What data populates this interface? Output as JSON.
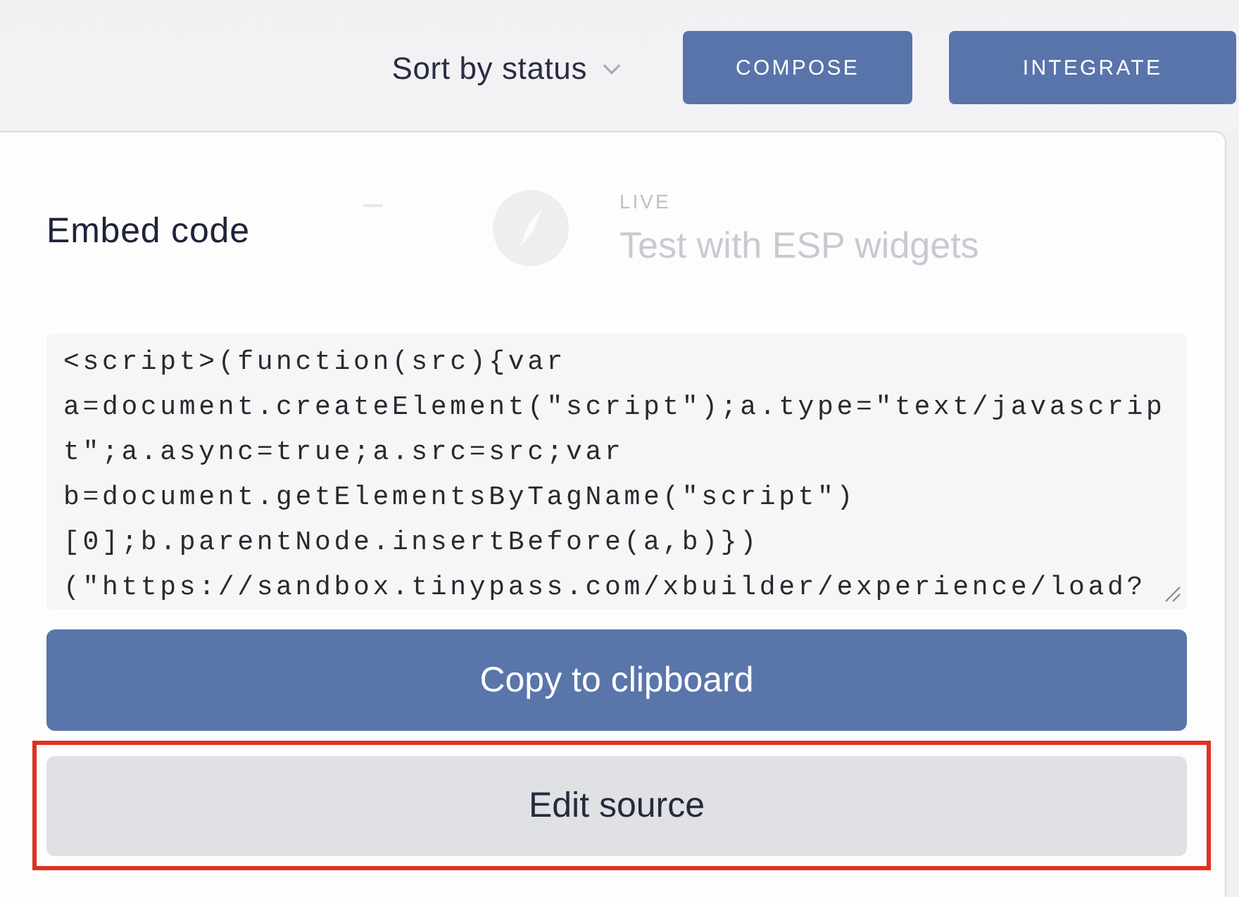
{
  "toolbar": {
    "sort": {
      "label": "Sort by status"
    },
    "buttons": [
      {
        "label": "COMPOSE"
      },
      {
        "label": "INTEGRATE"
      }
    ]
  },
  "background_item": {
    "status": "LIVE",
    "title": "Test with ESP widgets"
  },
  "embed_panel": {
    "title": "Embed code",
    "code": {
      "value": "<script>(function(src){var a=document.createElement(\"script\");a.type=\"text/javascript\";a.async=true;a.src=src;var b=document.getElementsByTagName(\"script\")[0];b.parentNode.insertBefore(a,b)})(\"https://sandbox.tinypass.com/xbuilder/experience/load?"
    },
    "buttons": [
      {
        "label": "Copy to clipboard",
        "kind": "primary",
        "highlighted": false
      },
      {
        "label": "Edit source",
        "kind": "secondary",
        "highlighted": true
      }
    ]
  }
}
